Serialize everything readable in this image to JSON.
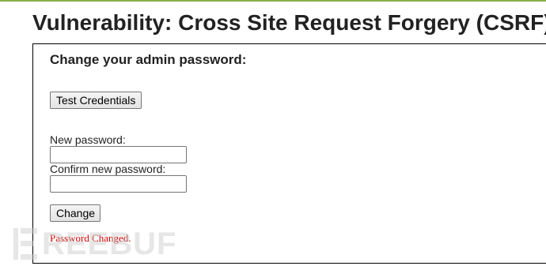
{
  "page": {
    "title": "Vulnerability: Cross Site Request Forgery (CSRF)"
  },
  "form": {
    "heading": "Change your admin password:",
    "test_button_label": "Test Credentials",
    "new_password_label": "New password:",
    "new_password_value": "",
    "confirm_password_label": "Confirm new password:",
    "confirm_password_value": "",
    "change_button_label": "Change"
  },
  "status": {
    "message": "Password Changed."
  },
  "watermark": {
    "text": "REEBUF"
  },
  "colors": {
    "top_rule": "#8bb04a",
    "status_text": "#cc0000",
    "box_border": "#000000"
  },
  "icons": {
    "watermark_logo": "freebuf-logo-icon"
  }
}
